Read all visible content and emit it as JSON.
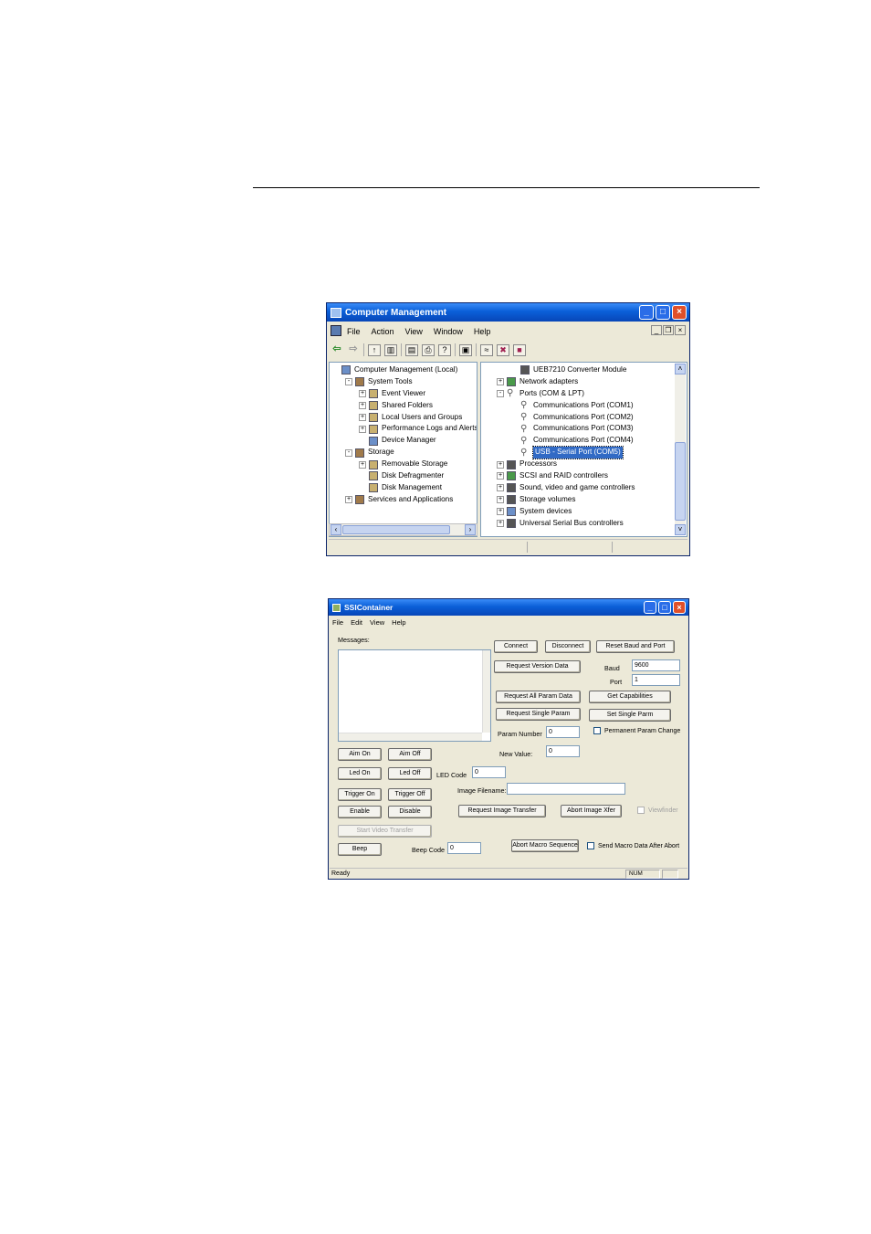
{
  "cm": {
    "title": "Computer Management",
    "menu": [
      "File",
      "Action",
      "View",
      "Window",
      "Help"
    ],
    "left_tree": [
      {
        "label": "Computer Management (Local)",
        "indent": 0,
        "exp": "none",
        "icon": "comp"
      },
      {
        "label": "System Tools",
        "indent": 1,
        "exp": "-",
        "icon": "tool2"
      },
      {
        "label": "Event Viewer",
        "indent": 2,
        "exp": "+",
        "icon": "folder"
      },
      {
        "label": "Shared Folders",
        "indent": 2,
        "exp": "+",
        "icon": "folder"
      },
      {
        "label": "Local Users and Groups",
        "indent": 2,
        "exp": "+",
        "icon": "folder"
      },
      {
        "label": "Performance Logs and Alerts",
        "indent": 2,
        "exp": "+",
        "icon": "folder"
      },
      {
        "label": "Device Manager",
        "indent": 2,
        "exp": "none",
        "icon": "comp"
      },
      {
        "label": "Storage",
        "indent": 1,
        "exp": "-",
        "icon": "tool2"
      },
      {
        "label": "Removable Storage",
        "indent": 2,
        "exp": "+",
        "icon": "folder"
      },
      {
        "label": "Disk Defragmenter",
        "indent": 2,
        "exp": "none",
        "icon": "folder"
      },
      {
        "label": "Disk Management",
        "indent": 2,
        "exp": "none",
        "icon": "folder"
      },
      {
        "label": "Services and Applications",
        "indent": 1,
        "exp": "+",
        "icon": "tool2"
      }
    ],
    "right_tree": [
      {
        "label": "UEB7210 Converter Module",
        "indent": 2,
        "exp": "none",
        "icon": "chip",
        "selected": false
      },
      {
        "label": "Network adapters",
        "indent": 1,
        "exp": "+",
        "icon": "net",
        "selected": false
      },
      {
        "label": "Ports (COM & LPT)",
        "indent": 1,
        "exp": "-",
        "icon": "port",
        "selected": false
      },
      {
        "label": "Communications Port (COM1)",
        "indent": 2,
        "exp": "none",
        "icon": "port",
        "selected": false
      },
      {
        "label": "Communications Port (COM2)",
        "indent": 2,
        "exp": "none",
        "icon": "port",
        "selected": false
      },
      {
        "label": "Communications Port (COM3)",
        "indent": 2,
        "exp": "none",
        "icon": "port",
        "selected": false
      },
      {
        "label": "Communications Port (COM4)",
        "indent": 2,
        "exp": "none",
        "icon": "port",
        "selected": false
      },
      {
        "label": "USB - Serial Port (COM5)",
        "indent": 2,
        "exp": "none",
        "icon": "port",
        "selected": true
      },
      {
        "label": "Processors",
        "indent": 1,
        "exp": "+",
        "icon": "chip",
        "selected": false
      },
      {
        "label": "SCSI and RAID controllers",
        "indent": 1,
        "exp": "+",
        "icon": "net",
        "selected": false
      },
      {
        "label": "Sound, video and game controllers",
        "indent": 1,
        "exp": "+",
        "icon": "chip",
        "selected": false
      },
      {
        "label": "Storage volumes",
        "indent": 1,
        "exp": "+",
        "icon": "chip",
        "selected": false
      },
      {
        "label": "System devices",
        "indent": 1,
        "exp": "+",
        "icon": "comp",
        "selected": false
      },
      {
        "label": "Universal Serial Bus controllers",
        "indent": 1,
        "exp": "+",
        "icon": "chip",
        "selected": false
      }
    ]
  },
  "ssi": {
    "title": "SSIContainer",
    "menu": [
      "File",
      "Edit",
      "View",
      "Help"
    ],
    "messages_label": "Messages:",
    "buttons": {
      "connect": "Connect",
      "disconnect": "Disconnect",
      "reset_baud": "Reset Baud and Port",
      "request_version": "Request Version Data",
      "request_all_param": "Request All Param Data",
      "get_capabilities": "Get Capabilities",
      "request_single_param": "Request Single Param",
      "set_single_parm": "Set Single Parm",
      "aim_on": "Aim On",
      "aim_off": "Aim Off",
      "led_on": "Led On",
      "led_off": "Led Off",
      "trigger_on": "Trigger On",
      "trigger_off": "Trigger Off",
      "enable": "Enable",
      "disable": "Disable",
      "start_video": "Start Video Transfer",
      "beep": "Beep",
      "request_image": "Request Image Transfer",
      "abort_image": "Abort Image Xfer",
      "abort_macro": "Abort Macro Sequence"
    },
    "labels": {
      "baud": "Baud",
      "port": "Port",
      "param_number": "Param Number",
      "new_value": "New Value:",
      "led_code": "LED Code",
      "image_filename": "Image Filename:",
      "beep_code": "Beep Code"
    },
    "values": {
      "baud": "9600",
      "port": "1",
      "param_number": "0",
      "new_value": "0",
      "led_code": "0",
      "image_filename": "",
      "beep_code": "0"
    },
    "checkboxes": {
      "permanent": "Permanent Param Change",
      "viewfinder": "Viewfinder",
      "send_macro": "Send Macro Data After Abort"
    },
    "status": {
      "text": "Ready",
      "num": "NUM"
    }
  }
}
